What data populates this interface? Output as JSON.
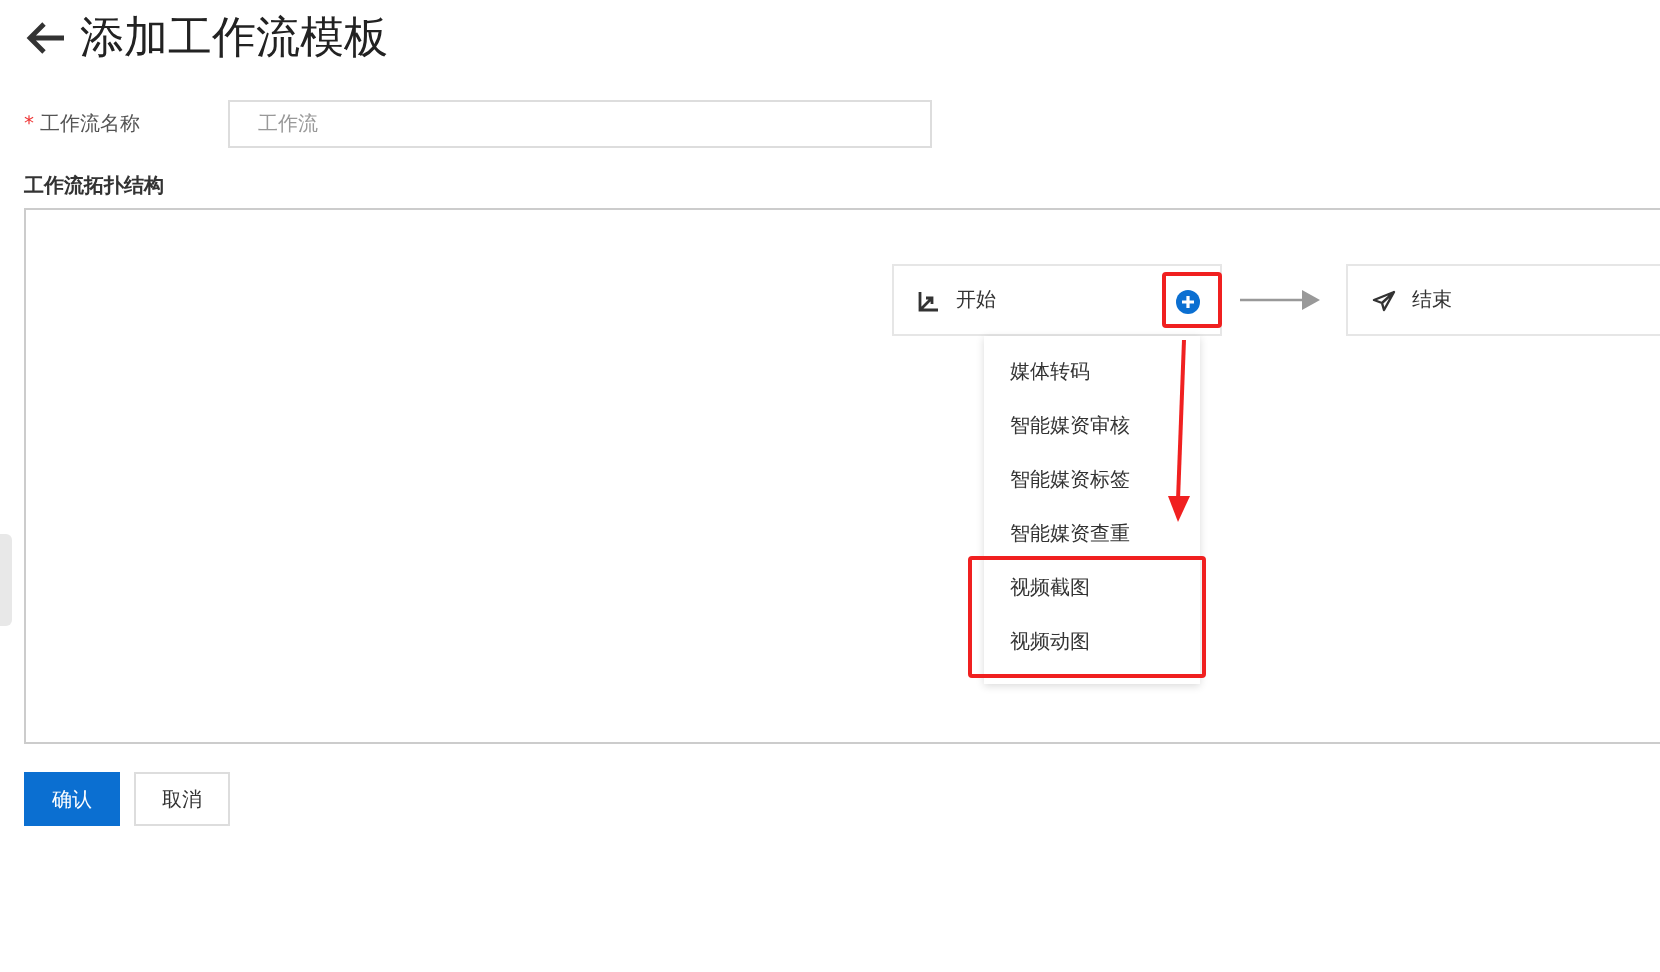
{
  "page": {
    "title": "添加工作流模板"
  },
  "form": {
    "name_field": {
      "label": "工作流名称",
      "required_mark": "*",
      "placeholder": "工作流"
    }
  },
  "topology": {
    "title": "工作流拓扑结构",
    "nodes": [
      {
        "kind": "start",
        "label": "开始"
      },
      {
        "kind": "end",
        "label": "结束"
      }
    ],
    "menu": [
      {
        "label": "媒体转码"
      },
      {
        "label": "智能媒资审核"
      },
      {
        "label": "智能媒资标签"
      },
      {
        "label": "智能媒资查重"
      },
      {
        "label": "视频截图"
      },
      {
        "label": "视频动图"
      }
    ]
  },
  "buttons": [
    {
      "kind": "primary",
      "label": "确认"
    },
    {
      "kind": "default",
      "label": "取消"
    }
  ]
}
